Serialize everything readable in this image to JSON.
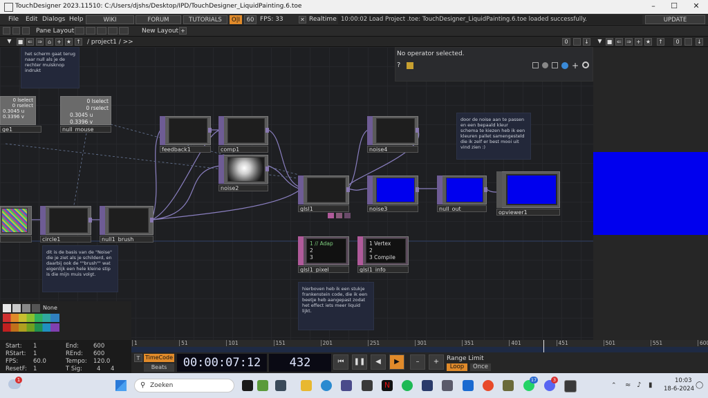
{
  "window": {
    "title": "TouchDesigner 2023.11510: C:/Users/djshs/Desktop/IPD/TouchDesigner_LiquidPainting.6.toe"
  },
  "menu": {
    "file": "File",
    "edit": "Edit",
    "dialogs": "Dialogs",
    "help": "Help",
    "wiki": "WIKI",
    "forum": "FORUM",
    "tutorials": "TUTORIALS",
    "oi": "O|I",
    "fps_box": "60",
    "fps_label": "FPS: 33",
    "realtime": "Realtime",
    "status": "10:00:02 Load Project .toe: TouchDesigner_LiquidPainting.6.toe loaded successfully.",
    "update": "UPDATE"
  },
  "toolbar": {
    "pane_layout": "Pane Layout",
    "new_layout": "New Layout"
  },
  "pane": {
    "path": "/ project1 / >>",
    "zoom": "0",
    "right_zoom": "0"
  },
  "info": {
    "text": "No operator selected."
  },
  "nodes": {
    "select_partial": "ge1",
    "null_mouse": "null_mouse",
    "null_mouse_v1": "0 lselect",
    "null_mouse_v2": "0 rselect",
    "null_mouse_v3": "0.3045 u",
    "null_mouse_v4": "0.3396 v",
    "sel_v1": "0 lselect",
    "sel_v2": "0 rselect",
    "sel_v3": "0.3045 u",
    "sel_v4": "0.3396 v",
    "feedback1": "feedback1",
    "comp1": "comp1",
    "noise2": "noise2",
    "noise4": "noise4",
    "glsl1": "glsl1",
    "noise3": "noise3",
    "null_out": "null_out",
    "opviewer1": "opviewer1",
    "circle1": "circle1",
    "null1_brush": "null1_brush",
    "glsl1_pixel": "glsl1_pixel",
    "glsl1_info": "glsl1_info",
    "pixel_l1": "1 // Adap",
    "pixel_l2": "2",
    "pixel_l3": "3",
    "info_l1": "1  Vertex",
    "info_l2": "2",
    "info_l3": "3  Compile"
  },
  "comments": {
    "c1": "het scherm gaat terug naar null als je de rechter muisknop indrukt",
    "c2": "door de noise aan te passen en een bepaald kleur schema te kiezen heb ik een kleuren pallet samengesteld die ik zelf er best mooi uit vind zien :)",
    "c3": "dit is de basis van de \"Noise\" die je ziet als je schilderd, en daarbij ook de \"\"brush\"\" wat eigenlijk een hele kleine stip is die mijn muis volgt.",
    "c4": "hierboven heb ik een stukje frankenstein code, die ik een beetje heb aangepast zodat het effect iets meer liquid lijkt."
  },
  "palette": {
    "none": "None"
  },
  "timeinfo": {
    "start_l": "Start:",
    "start_v": "1",
    "rstart_l": "RStart:",
    "rstart_v": "1",
    "fps_l": "FPS:",
    "fps_v": "60.0",
    "resetf_l": "ResetF:",
    "resetf_v": "1",
    "end_l": "End:",
    "end_v": "600",
    "rend_l": "REnd:",
    "rend_v": "600",
    "tempo_l": "Tempo:",
    "tempo_v": "120.0",
    "tsig_l": "T Sig:",
    "tsig_v1": "4",
    "tsig_v2": "4"
  },
  "timeline": {
    "ticks": [
      "1",
      "51",
      "101",
      "151",
      "201",
      "251",
      "301",
      "351",
      "401",
      "451",
      "501",
      "551",
      "600"
    ]
  },
  "transport": {
    "timecode": "TimeCode",
    "beats": "Beats",
    "time": "00:00:07:12",
    "frame": "432",
    "range_limit": "Range Limit",
    "loop": "Loop",
    "once": "Once"
  },
  "taskbar": {
    "search": "Zoeken",
    "time": "10:03",
    "date": "18-6-2024",
    "weather_badge": "1",
    "badge_whatsapp": "17",
    "badge_discord": "3"
  },
  "colors": {
    "accent": "#e08a2a",
    "blue_out": "#0000ee",
    "node_inlet": "#6e5c95"
  }
}
